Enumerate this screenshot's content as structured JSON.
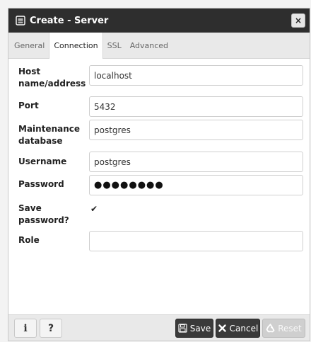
{
  "dialog": {
    "title": "Create - Server",
    "close_symbol": "×"
  },
  "tabs": [
    {
      "label": "General",
      "active": false
    },
    {
      "label": "Connection",
      "active": true
    },
    {
      "label": "SSL",
      "active": false
    },
    {
      "label": "Advanced",
      "active": false
    }
  ],
  "form": {
    "host": {
      "label_line1": "Host",
      "label_line2": "name/address",
      "value": "localhost"
    },
    "port": {
      "label": "Port",
      "value": "5432"
    },
    "maintenance_db": {
      "label_line1": "Maintenance",
      "label_line2": "database",
      "value": "postgres"
    },
    "username": {
      "label": "Username",
      "value": "postgres"
    },
    "password": {
      "label": "Password",
      "value": "●●●●●●●●"
    },
    "save_password": {
      "label_line1": "Save",
      "label_line2": "password?",
      "checked": true,
      "check_symbol": "✔"
    },
    "role": {
      "label": "Role",
      "value": ""
    }
  },
  "footer": {
    "info_label": "i",
    "help_label": "?",
    "save_label": "Save",
    "cancel_label": "Cancel",
    "reset_label": "Reset"
  },
  "icons": {
    "title": "server-icon",
    "save": "floppy-disk-icon",
    "cancel": "x-icon",
    "reset": "recycle-icon"
  }
}
